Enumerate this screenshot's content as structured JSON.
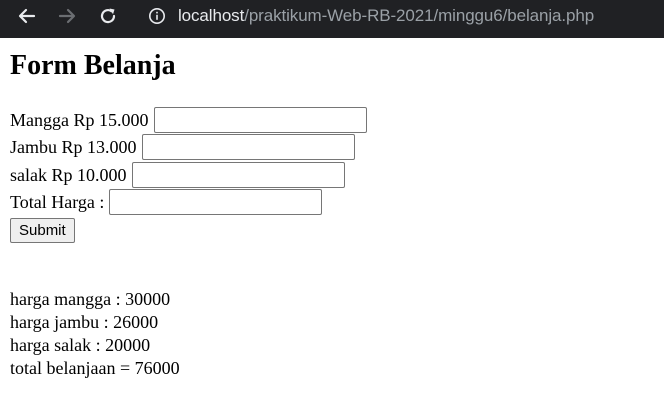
{
  "browser": {
    "url_host": "localhost",
    "url_path": "/praktikum-Web-RB-2021/minggu6/belanja.php"
  },
  "page": {
    "title": "Form Belanja",
    "fields": [
      {
        "label": "Mangga Rp 15.000",
        "value": ""
      },
      {
        "label": "Jambu Rp 13.000",
        "value": ""
      },
      {
        "label": "salak Rp 10.000",
        "value": ""
      },
      {
        "label": "Total Harga :",
        "value": ""
      }
    ],
    "submit_label": "Submit",
    "results": [
      "harga mangga : 30000",
      "harga jambu : 26000",
      "harga salak : 20000",
      "total belanjaan = 76000"
    ]
  },
  "icons": {
    "back": "arrow-left-icon",
    "forward": "arrow-right-icon",
    "reload": "reload-icon",
    "info": "info-icon"
  },
  "colors": {
    "toolbar_bg": "#202124",
    "url_host": "#e8eaed",
    "url_path": "#9aa0a6"
  }
}
